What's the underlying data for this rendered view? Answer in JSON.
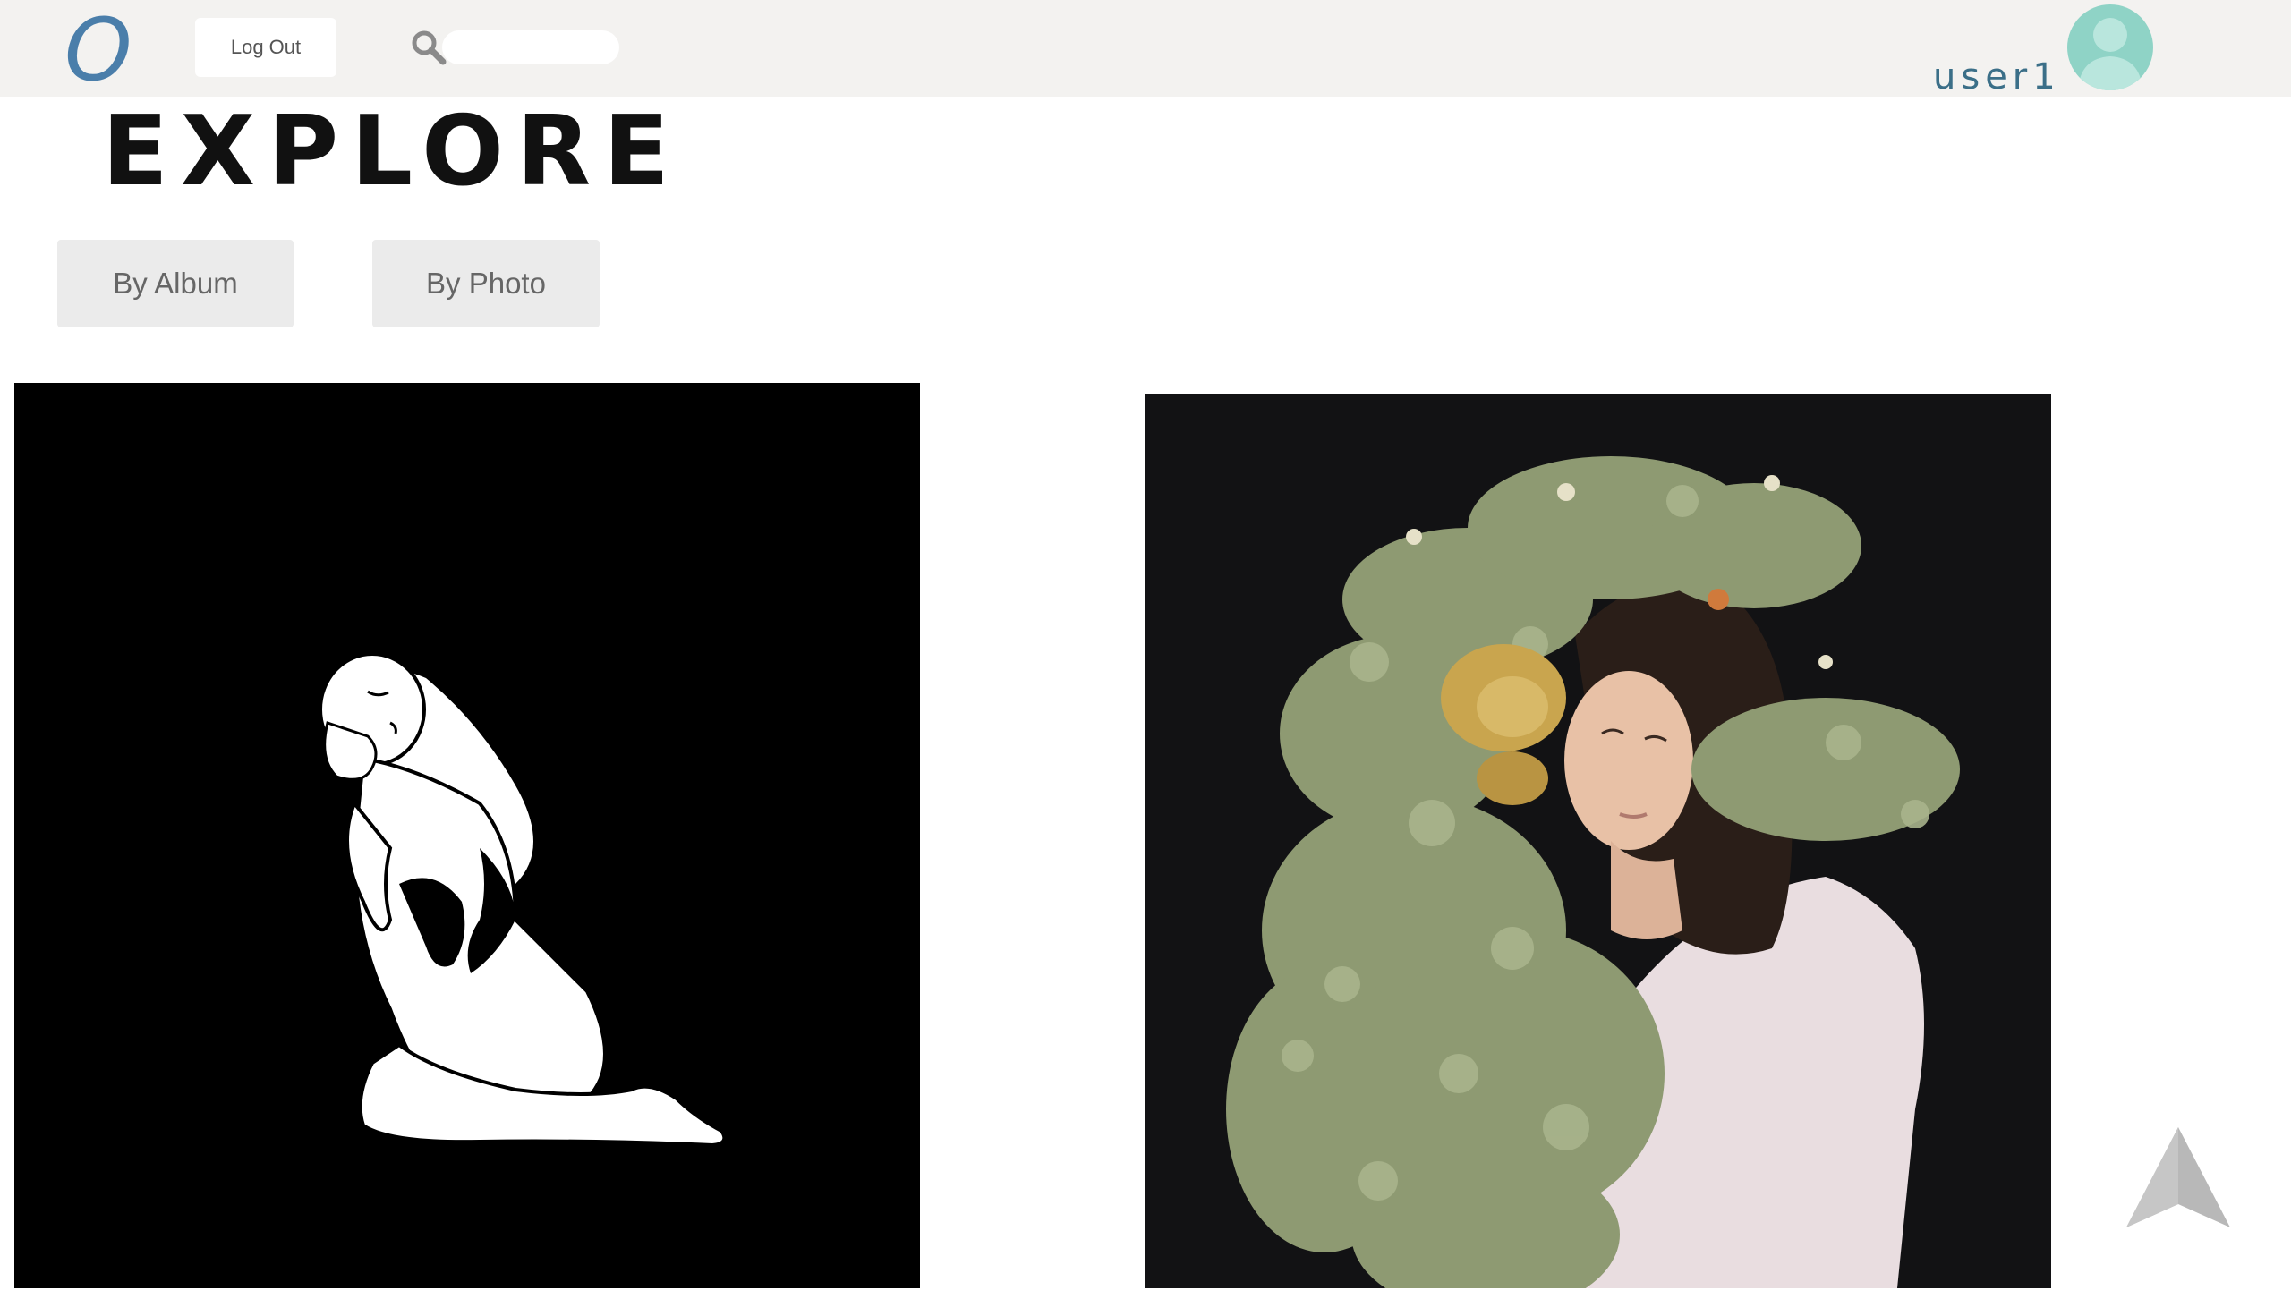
{
  "header": {
    "logo_text": "O",
    "logout_label": "Log Out",
    "search": {
      "value": "",
      "placeholder": ""
    },
    "username": "user1"
  },
  "page": {
    "title": "EXPLORE"
  },
  "tabs": [
    {
      "label": "By Album"
    },
    {
      "label": "By Photo"
    }
  ],
  "photos": [
    {
      "subject": "illustration-kneeling-woman"
    },
    {
      "subject": "portrait-woman-with-foliage"
    }
  ],
  "icons": {
    "search": "search-icon",
    "avatar": "user-avatar-icon",
    "scroll_top": "arrow-up-icon"
  },
  "colors": {
    "topbar": "#f3f2f0",
    "logo": "#4a7eaa",
    "username": "#3b6f88",
    "avatar": "#8fd3c6",
    "tab_bg": "#ebebeb"
  }
}
